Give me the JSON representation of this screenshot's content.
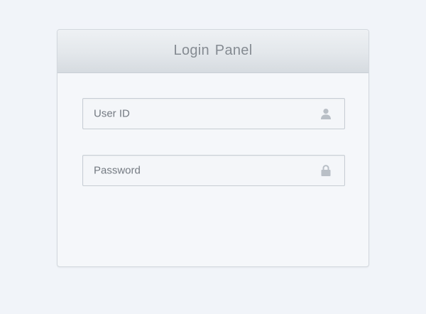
{
  "panel": {
    "title": "Login Panel"
  },
  "fields": {
    "user_id": {
      "label": "User ID",
      "value": "",
      "icon": "user-icon"
    },
    "password": {
      "label": "Password",
      "value": "",
      "icon": "lock-icon"
    }
  },
  "colors": {
    "background": "#f1f4f9",
    "header_gradient_top": "#eef1f4",
    "header_gradient_bottom": "#d6dbe0",
    "title_text": "#858b92",
    "field_border": "#c7cdd4",
    "icon": "#b9bfc6"
  }
}
